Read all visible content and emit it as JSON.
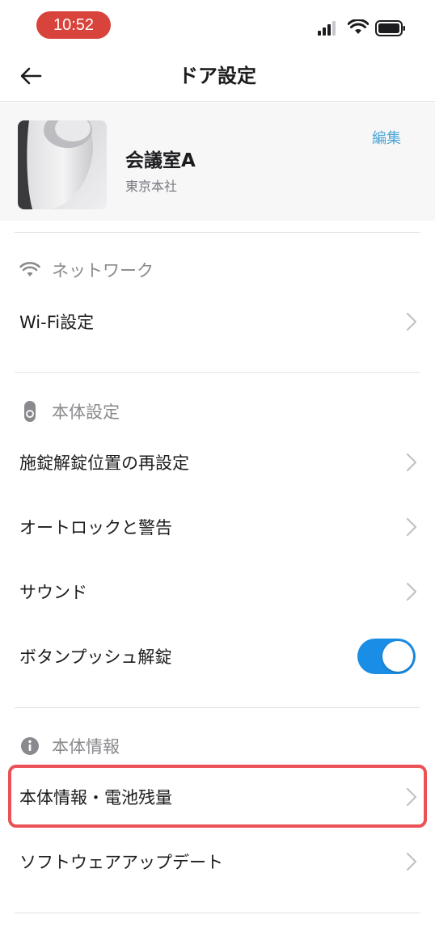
{
  "status_bar": {
    "time": "10:52"
  },
  "nav": {
    "title": "ドア設定"
  },
  "device": {
    "name": "会議室A",
    "location": "東京本社",
    "edit_label": "編集"
  },
  "sections": {
    "network": {
      "header": "ネットワーク",
      "items": [
        {
          "label": "Wi-Fi設定"
        }
      ]
    },
    "body_settings": {
      "header": "本体設定",
      "items": [
        {
          "label": "施錠解錠位置の再設定"
        },
        {
          "label": "オートロックと警告"
        },
        {
          "label": "サウンド"
        },
        {
          "label": "ボタンプッシュ解錠",
          "toggle": true
        }
      ]
    },
    "body_info": {
      "header": "本体情報",
      "items": [
        {
          "label": "本体情報・電池残量",
          "highlighted": true
        },
        {
          "label": "ソフトウェアアップデート"
        }
      ]
    }
  },
  "colors": {
    "time_pill": "#d8433b",
    "accent": "#4aa6d6",
    "toggle_on": "#1a8ee6",
    "highlight": "#ea5257"
  }
}
